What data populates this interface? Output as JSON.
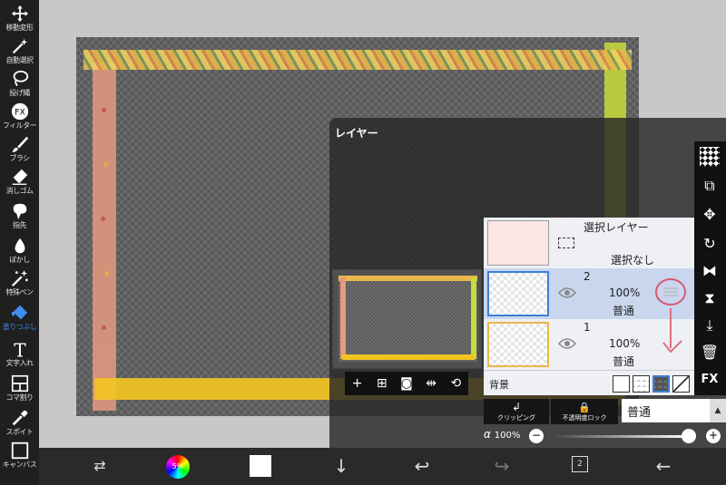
{
  "left_toolbar": {
    "tools": [
      {
        "label": "移動変形",
        "icon": "move-icon"
      },
      {
        "label": "自動選択",
        "icon": "magic-wand-icon"
      },
      {
        "label": "投げ縄",
        "icon": "lasso-icon"
      },
      {
        "label": "フィルター",
        "icon": "fx-icon"
      },
      {
        "label": "ブラシ",
        "icon": "brush-icon"
      },
      {
        "label": "消しゴム",
        "icon": "eraser-icon"
      },
      {
        "label": "指先",
        "icon": "smudge-icon"
      },
      {
        "label": "ぼかし",
        "icon": "blur-icon"
      },
      {
        "label": "特殊ペン",
        "icon": "special-pen-icon"
      },
      {
        "label": "塗りつぶし",
        "icon": "bucket-icon"
      },
      {
        "label": "文字入れ",
        "icon": "text-icon"
      },
      {
        "label": "コマ割り",
        "icon": "frame-divider-icon"
      },
      {
        "label": "スポイト",
        "icon": "eyedropper-icon"
      },
      {
        "label": "キャンバス",
        "icon": "canvas-icon"
      }
    ],
    "active_tool": "塗りつぶし"
  },
  "layer_panel": {
    "title": "レイヤー",
    "selection_layer": {
      "title": "選択レイヤー",
      "status": "選択なし"
    },
    "layers": [
      {
        "number": "2",
        "opacity": "100%",
        "mode": "普通",
        "selected": true
      },
      {
        "number": "1",
        "opacity": "100%",
        "mode": "普通",
        "selected": false
      }
    ],
    "background_label": "背景",
    "clipping_label": "クリッピング",
    "opacity_lock_label": "不透明度ロック",
    "blend_mode": "普通",
    "alpha_label": "α",
    "alpha_value": "100%",
    "fx_label": "FX"
  },
  "bottom_bar": {
    "brush_size": "5%",
    "layer_count": "2"
  },
  "colors": {
    "accent": "#3e8ef0",
    "selected_row": "#c9d6ee",
    "tape_yellow": "#f2c422",
    "tape_pink": "#e59a80",
    "tape_green": "#c8dc3a"
  }
}
